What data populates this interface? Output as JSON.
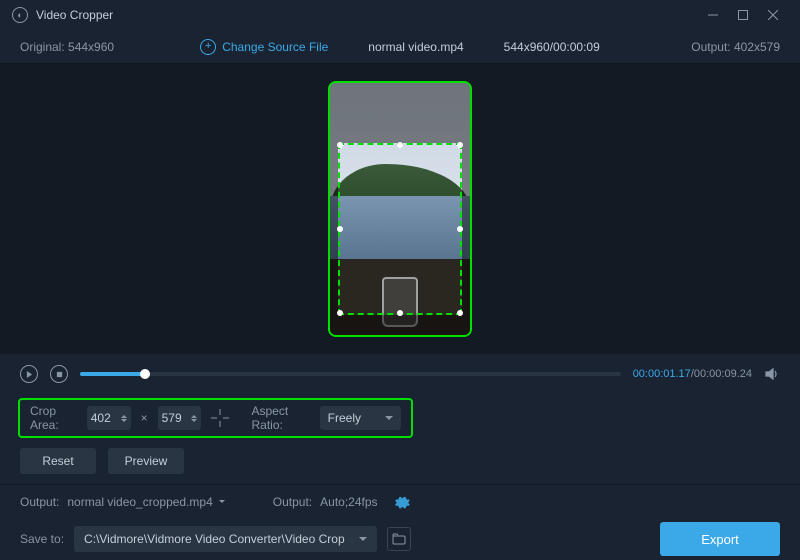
{
  "title": "Video Cropper",
  "infobar": {
    "original_label": "Original:",
    "original_value": "544x960",
    "change_source": "Change Source File",
    "filename": "normal video.mp4",
    "src_meta": "544x960/00:00:09",
    "output_label": "Output:",
    "output_value": "402x579"
  },
  "time": {
    "current": "00:00:01.17",
    "total": "00:00:09.24"
  },
  "crop": {
    "area_label": "Crop Area:",
    "width": "402",
    "height": "579",
    "times": "×",
    "ratio_label": "Aspect Ratio:",
    "ratio_value": "Freely"
  },
  "buttons": {
    "reset": "Reset",
    "preview": "Preview",
    "export": "Export"
  },
  "output": {
    "label1": "Output:",
    "filename": "normal video_cropped.mp4",
    "label2": "Output:",
    "format": "Auto;24fps"
  },
  "save": {
    "label": "Save to:",
    "path": "C:\\Vidmore\\Vidmore Video Converter\\Video Crop"
  }
}
